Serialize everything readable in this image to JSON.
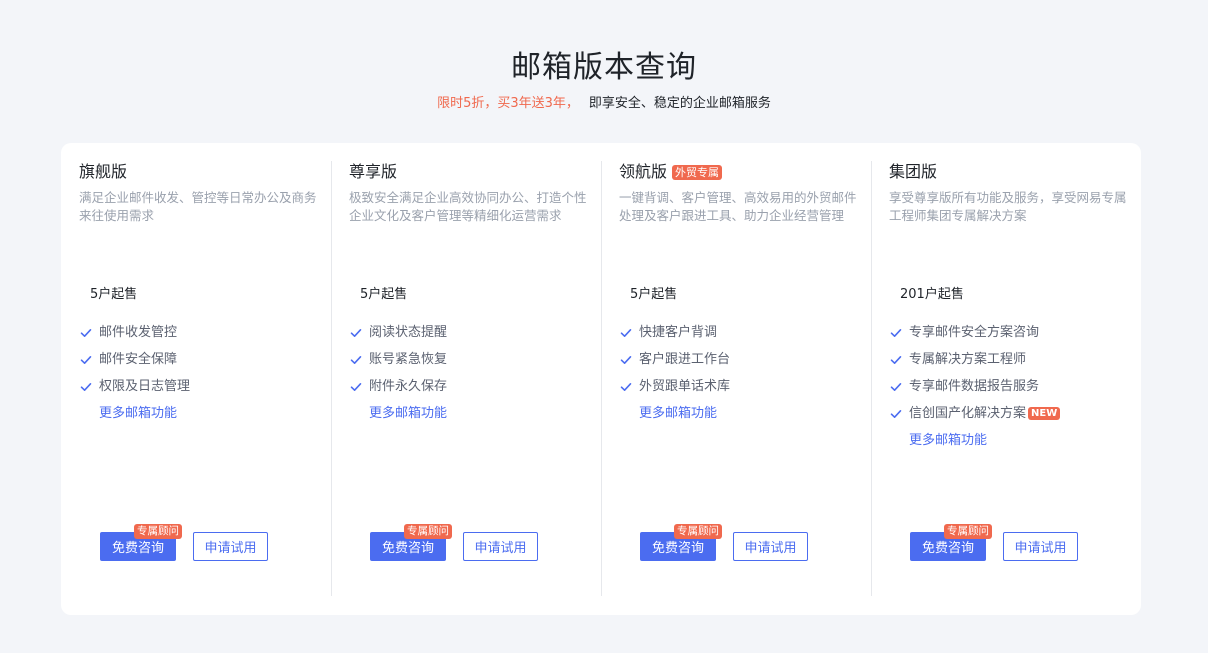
{
  "header": {
    "title": "邮箱版本查询",
    "promo": "限时5折，买3年送3年，",
    "desc": "即享安全、稳定的企业邮箱服务"
  },
  "colors": {
    "accent": "#4b6cf0",
    "promo": "#f0694e",
    "background": "#f3f5f9"
  },
  "icons": {
    "feature": "check-icon"
  },
  "plans": [
    {
      "name": "旗舰版",
      "tag": "",
      "desc": "满足企业邮件收发、管控等日常办公及商务来往使用需求",
      "min_users": "5户起售",
      "features": [
        "邮件收发管控",
        "邮件安全保障",
        "权限及日志管理"
      ],
      "more": "更多邮箱功能",
      "consult_label": "免费咨询",
      "consult_badge": "专属顾问",
      "trial_label": "申请试用"
    },
    {
      "name": "尊享版",
      "tag": "",
      "desc": "极致安全满足企业高效协同办公、打造个性企业文化及客户管理等精细化运营需求",
      "min_users": "5户起售",
      "features": [
        "阅读状态提醒",
        "账号紧急恢复",
        "附件永久保存"
      ],
      "more": "更多邮箱功能",
      "consult_label": "免费咨询",
      "consult_badge": "专属顾问",
      "trial_label": "申请试用"
    },
    {
      "name": "领航版",
      "tag": "外贸专属",
      "desc": "一键背调、客户管理、高效易用的外贸邮件处理及客户跟进工具、助力企业经营管理",
      "min_users": "5户起售",
      "features": [
        "快捷客户背调",
        "客户跟进工作台",
        "外贸跟单话术库"
      ],
      "more": "更多邮箱功能",
      "consult_label": "免费咨询",
      "consult_badge": "专属顾问",
      "trial_label": "申请试用"
    },
    {
      "name": "集团版",
      "tag": "",
      "desc": "享受尊享版所有功能及服务，享受网易专属工程师集团专属解决方案",
      "min_users": "201户起售",
      "features": [
        "专享邮件安全方案咨询",
        "专属解决方案工程师",
        "专享邮件数据报告服务",
        "信创国产化解决方案"
      ],
      "feature_badge": "NEW",
      "more": "更多邮箱功能",
      "consult_label": "免费咨询",
      "consult_badge": "专属顾问",
      "trial_label": "申请试用"
    }
  ]
}
